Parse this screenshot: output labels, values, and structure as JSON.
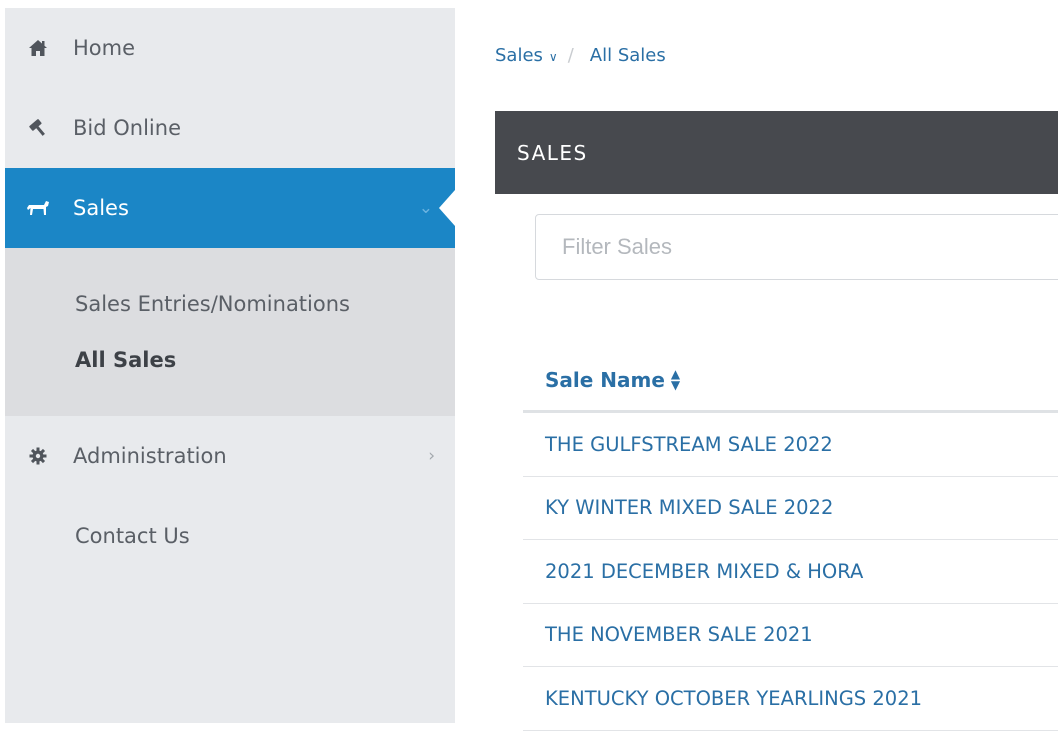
{
  "sidebar": {
    "items": [
      {
        "label": "Home",
        "icon": "home-icon"
      },
      {
        "label": "Bid Online",
        "icon": "gavel-icon"
      },
      {
        "label": "Sales",
        "icon": "horse-icon",
        "active": true
      },
      {
        "label": "Administration",
        "icon": "gear-icon"
      },
      {
        "label": "Contact Us"
      }
    ],
    "submenu": [
      {
        "label": "Sales Entries/Nominations"
      },
      {
        "label": "All Sales",
        "current": true
      }
    ]
  },
  "breadcrumb": {
    "parent": "Sales",
    "separator": "/",
    "current": "All Sales"
  },
  "panel": {
    "title": "SALES"
  },
  "filter": {
    "placeholder": "Filter Sales",
    "value": ""
  },
  "table": {
    "column_header": "Sale Name",
    "rows": [
      "THE GULFSTREAM SALE 2022",
      "KY WINTER MIXED SALE 2022",
      "2021 DECEMBER MIXED & HORA",
      "THE NOVEMBER SALE 2021",
      "KENTUCKY OCTOBER YEARLINGS 2021"
    ]
  },
  "colors": {
    "accent": "#1b86c6",
    "link": "#2a6fa5",
    "panel_header": "#47494e",
    "sidebar_bg": "#e8eaed"
  }
}
